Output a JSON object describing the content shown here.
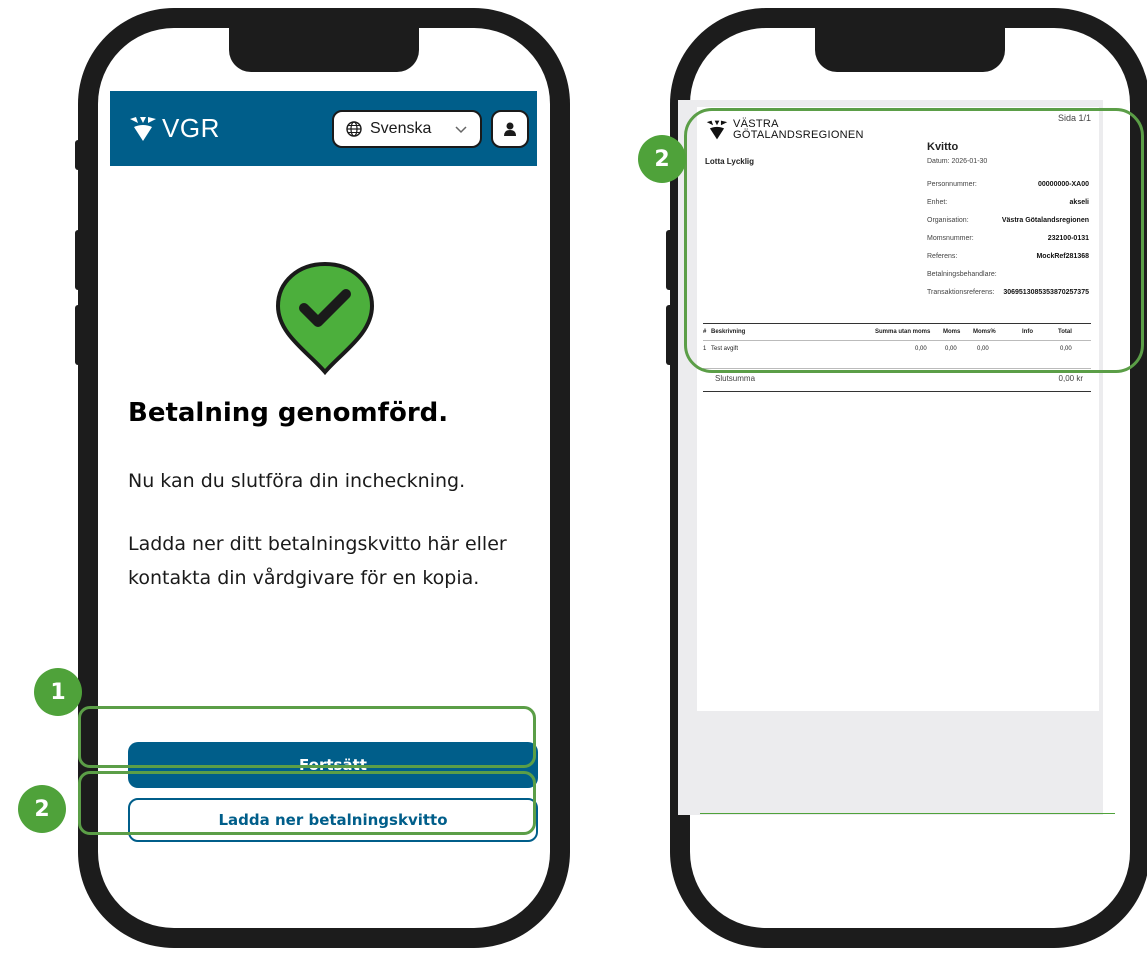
{
  "left_phone": {
    "header": {
      "logo_text": "VGR",
      "language_label": "Svenska"
    },
    "title": "Betalning genomförd.",
    "paragraph1": "Nu kan du slutföra din incheckning.",
    "paragraph2": "Ladda ner ditt betalningskvitto här eller kontakta din vårdgivare för en kopia.",
    "primary_button": "Fortsätt",
    "secondary_button": "Ladda ner betalningskvitto",
    "markers": [
      "1",
      "2"
    ]
  },
  "right_phone": {
    "marker": "2",
    "receipt": {
      "page": "Sida 1/1",
      "logo_line1": "VÄSTRA",
      "logo_line2": "GÖTALANDSREGIONEN",
      "customer_name": "Lotta Lycklig",
      "title": "Kvitto",
      "date": "Datum: 2026-01-30",
      "fields": [
        {
          "label": "Personnummer:",
          "value": "00000000-XA00"
        },
        {
          "label": "Enhet:",
          "value": "akseli"
        },
        {
          "label": "Organisation:",
          "value": "Västra Götalandsregionen"
        },
        {
          "label": "Momsnummer:",
          "value": "232100-0131"
        },
        {
          "label": "Referens:",
          "value": "MockRef281368"
        },
        {
          "label": "Betalningsbehandlare:",
          "value": ""
        },
        {
          "label": "Transaktionsreferens:",
          "value": "306951308535387025737​5"
        }
      ],
      "table": {
        "headers": [
          "#",
          "Beskrivning",
          "Summa utan moms",
          "Moms",
          "Moms%",
          "Info",
          "Total"
        ],
        "rows": [
          [
            "1",
            "Test avgift",
            "0,00",
            "0,00",
            "0,00",
            "",
            "0,00"
          ]
        ]
      },
      "sum_label": "Slutsumma",
      "sum_value": "0,00 kr"
    }
  },
  "colors": {
    "brand_blue": "#005e8a",
    "highlight_green": "#5b9e47",
    "success_green": "#4caf3c"
  }
}
